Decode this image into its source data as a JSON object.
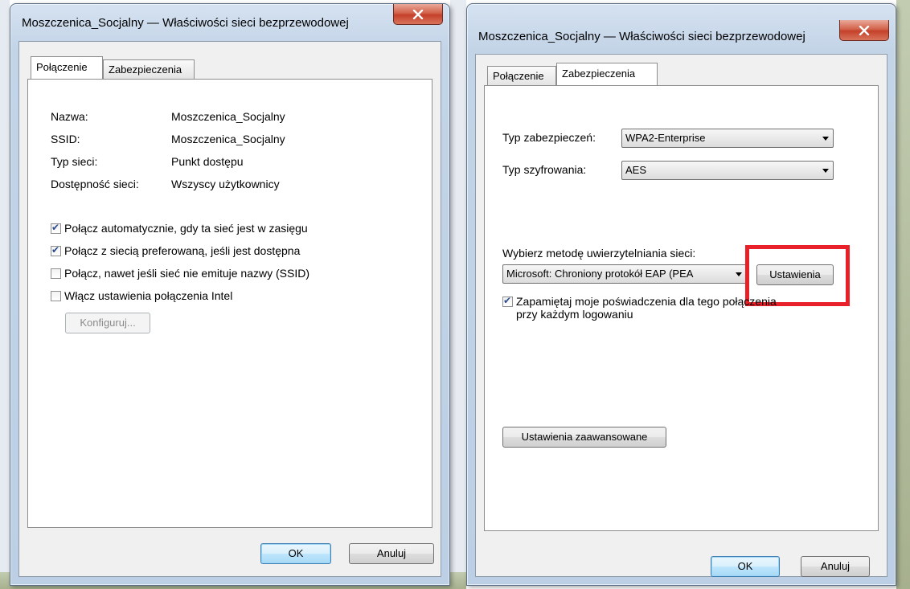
{
  "left_window": {
    "title": "Moszczenica_Socjalny — Właściwości sieci bezprzewodowej",
    "tabs": [
      {
        "label": "Połączenie",
        "active": true
      },
      {
        "label": "Zabezpieczenia",
        "active": false
      }
    ],
    "properties": [
      {
        "label": "Nazwa:",
        "value": "Moszczenica_Socjalny"
      },
      {
        "label": "SSID:",
        "value": "Moszczenica_Socjalny"
      },
      {
        "label": "Typ sieci:",
        "value": "Punkt dostępu"
      },
      {
        "label": "Dostępność sieci:",
        "value": "Wszyscy użytkownicy"
      }
    ],
    "checkboxes": [
      {
        "label": "Połącz automatycznie, gdy ta sieć jest w zasięgu",
        "checked": true
      },
      {
        "label": "Połącz z siecią preferowaną, jeśli jest dostępna",
        "checked": true
      },
      {
        "label": "Połącz, nawet jeśli sieć nie emituje nazwy (SSID)",
        "checked": false
      },
      {
        "label": "Włącz ustawienia połączenia Intel",
        "checked": false
      }
    ],
    "configure_button": "Konfiguruj...",
    "ok_button": "OK",
    "cancel_button": "Anuluj"
  },
  "right_window": {
    "title": "Moszczenica_Socjalny — Właściwości sieci bezprzewodowej",
    "tabs": [
      {
        "label": "Połączenie",
        "active": false
      },
      {
        "label": "Zabezpieczenia",
        "active": true
      }
    ],
    "security_type_label": "Typ zabezpieczeń:",
    "security_type_value": "WPA2-Enterprise",
    "encryption_type_label": "Typ szyfrowania:",
    "encryption_type_value": "AES",
    "auth_method_label": "Wybierz metodę uwierzytelniania sieci:",
    "auth_method_value": "Microsoft: Chroniony protokół EAP (PEA",
    "settings_button": "Ustawienia",
    "remember_checkbox_line1": "Zapamiętaj moje poświadczenia dla tego połączenia",
    "remember_checkbox_line2": "przy każdym logowaniu",
    "remember_checked": true,
    "advanced_button": "Ustawienia zaawansowane",
    "ok_button": "OK",
    "cancel_button": "Anuluj",
    "highlight_color": "#e8202a"
  }
}
